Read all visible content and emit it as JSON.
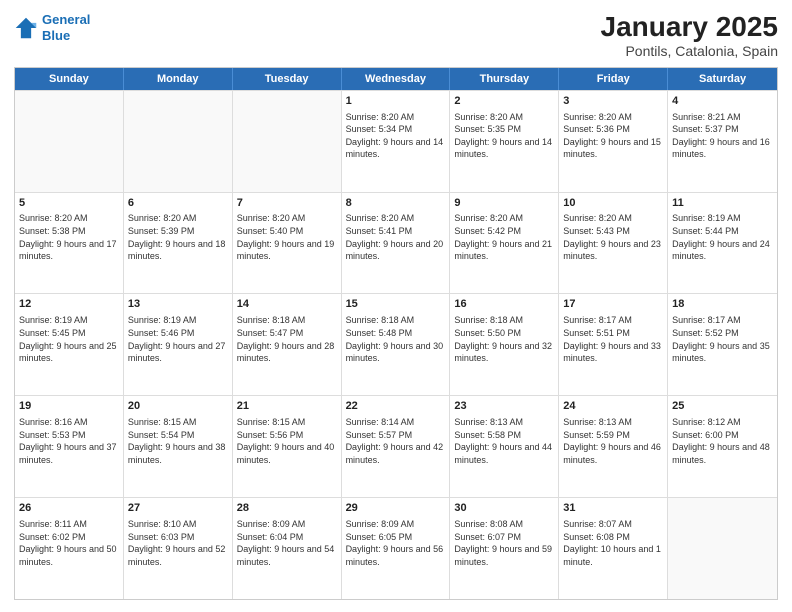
{
  "logo": {
    "line1": "General",
    "line2": "Blue"
  },
  "title": "January 2025",
  "subtitle": "Pontils, Catalonia, Spain",
  "days": [
    "Sunday",
    "Monday",
    "Tuesday",
    "Wednesday",
    "Thursday",
    "Friday",
    "Saturday"
  ],
  "rows": [
    [
      {
        "day": "",
        "empty": true
      },
      {
        "day": "",
        "empty": true
      },
      {
        "day": "",
        "empty": true
      },
      {
        "day": "1",
        "sunrise": "8:20 AM",
        "sunset": "5:34 PM",
        "daylight": "9 hours and 14 minutes."
      },
      {
        "day": "2",
        "sunrise": "8:20 AM",
        "sunset": "5:35 PM",
        "daylight": "9 hours and 14 minutes."
      },
      {
        "day": "3",
        "sunrise": "8:20 AM",
        "sunset": "5:36 PM",
        "daylight": "9 hours and 15 minutes."
      },
      {
        "day": "4",
        "sunrise": "8:21 AM",
        "sunset": "5:37 PM",
        "daylight": "9 hours and 16 minutes."
      }
    ],
    [
      {
        "day": "5",
        "sunrise": "8:20 AM",
        "sunset": "5:38 PM",
        "daylight": "9 hours and 17 minutes."
      },
      {
        "day": "6",
        "sunrise": "8:20 AM",
        "sunset": "5:39 PM",
        "daylight": "9 hours and 18 minutes."
      },
      {
        "day": "7",
        "sunrise": "8:20 AM",
        "sunset": "5:40 PM",
        "daylight": "9 hours and 19 minutes."
      },
      {
        "day": "8",
        "sunrise": "8:20 AM",
        "sunset": "5:41 PM",
        "daylight": "9 hours and 20 minutes."
      },
      {
        "day": "9",
        "sunrise": "8:20 AM",
        "sunset": "5:42 PM",
        "daylight": "9 hours and 21 minutes."
      },
      {
        "day": "10",
        "sunrise": "8:20 AM",
        "sunset": "5:43 PM",
        "daylight": "9 hours and 23 minutes."
      },
      {
        "day": "11",
        "sunrise": "8:19 AM",
        "sunset": "5:44 PM",
        "daylight": "9 hours and 24 minutes."
      }
    ],
    [
      {
        "day": "12",
        "sunrise": "8:19 AM",
        "sunset": "5:45 PM",
        "daylight": "9 hours and 25 minutes."
      },
      {
        "day": "13",
        "sunrise": "8:19 AM",
        "sunset": "5:46 PM",
        "daylight": "9 hours and 27 minutes."
      },
      {
        "day": "14",
        "sunrise": "8:18 AM",
        "sunset": "5:47 PM",
        "daylight": "9 hours and 28 minutes."
      },
      {
        "day": "15",
        "sunrise": "8:18 AM",
        "sunset": "5:48 PM",
        "daylight": "9 hours and 30 minutes."
      },
      {
        "day": "16",
        "sunrise": "8:18 AM",
        "sunset": "5:50 PM",
        "daylight": "9 hours and 32 minutes."
      },
      {
        "day": "17",
        "sunrise": "8:17 AM",
        "sunset": "5:51 PM",
        "daylight": "9 hours and 33 minutes."
      },
      {
        "day": "18",
        "sunrise": "8:17 AM",
        "sunset": "5:52 PM",
        "daylight": "9 hours and 35 minutes."
      }
    ],
    [
      {
        "day": "19",
        "sunrise": "8:16 AM",
        "sunset": "5:53 PM",
        "daylight": "9 hours and 37 minutes."
      },
      {
        "day": "20",
        "sunrise": "8:15 AM",
        "sunset": "5:54 PM",
        "daylight": "9 hours and 38 minutes."
      },
      {
        "day": "21",
        "sunrise": "8:15 AM",
        "sunset": "5:56 PM",
        "daylight": "9 hours and 40 minutes."
      },
      {
        "day": "22",
        "sunrise": "8:14 AM",
        "sunset": "5:57 PM",
        "daylight": "9 hours and 42 minutes."
      },
      {
        "day": "23",
        "sunrise": "8:13 AM",
        "sunset": "5:58 PM",
        "daylight": "9 hours and 44 minutes."
      },
      {
        "day": "24",
        "sunrise": "8:13 AM",
        "sunset": "5:59 PM",
        "daylight": "9 hours and 46 minutes."
      },
      {
        "day": "25",
        "sunrise": "8:12 AM",
        "sunset": "6:00 PM",
        "daylight": "9 hours and 48 minutes."
      }
    ],
    [
      {
        "day": "26",
        "sunrise": "8:11 AM",
        "sunset": "6:02 PM",
        "daylight": "9 hours and 50 minutes."
      },
      {
        "day": "27",
        "sunrise": "8:10 AM",
        "sunset": "6:03 PM",
        "daylight": "9 hours and 52 minutes."
      },
      {
        "day": "28",
        "sunrise": "8:09 AM",
        "sunset": "6:04 PM",
        "daylight": "9 hours and 54 minutes."
      },
      {
        "day": "29",
        "sunrise": "8:09 AM",
        "sunset": "6:05 PM",
        "daylight": "9 hours and 56 minutes."
      },
      {
        "day": "30",
        "sunrise": "8:08 AM",
        "sunset": "6:07 PM",
        "daylight": "9 hours and 59 minutes."
      },
      {
        "day": "31",
        "sunrise": "8:07 AM",
        "sunset": "6:08 PM",
        "daylight": "10 hours and 1 minute."
      },
      {
        "day": "",
        "empty": true
      }
    ]
  ],
  "labels": {
    "sunrise_prefix": "Sunrise: ",
    "sunset_prefix": "Sunset: ",
    "daylight_prefix": "Daylight: "
  }
}
